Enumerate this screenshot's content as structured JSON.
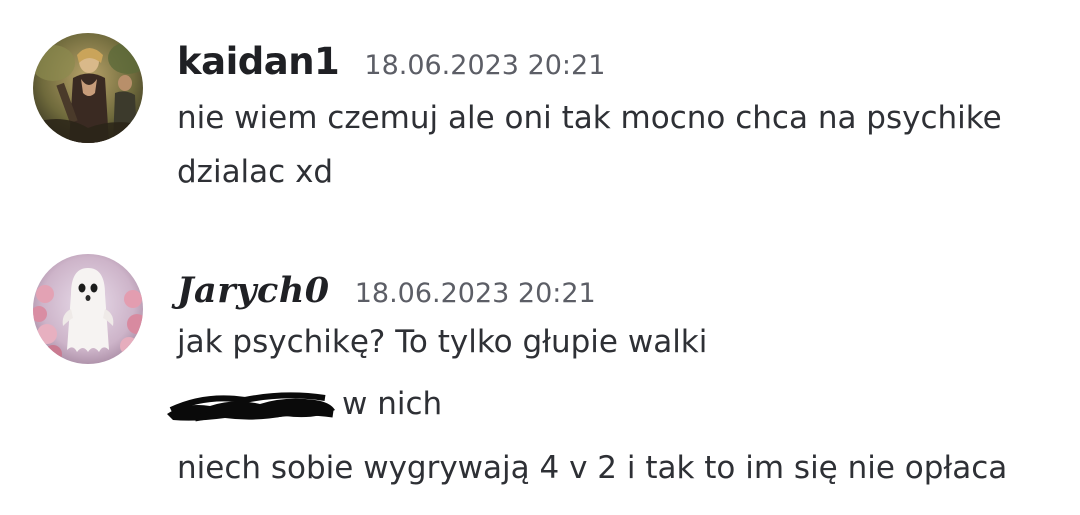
{
  "messages": [
    {
      "username": "kaidan1",
      "timestamp": "18.06.2023 20:21",
      "avatar_icon": "warrior-avatar-icon",
      "lines": [
        "nie wiem czemuj ale oni tak mocno chca na psychike",
        "dzialac xd"
      ]
    },
    {
      "username": "Jarych0",
      "timestamp": "18.06.2023 20:21",
      "avatar_icon": "ghost-avatar-icon",
      "lines": [
        "jak psychikę? To tylko głupie walki",
        "w nich",
        "niech sobie wygrywają 4 v 2 i tak to im się nie opłaca"
      ]
    }
  ],
  "colors": {
    "background": "#ffffff",
    "text": "#2e3035",
    "username": "#1f2024",
    "timestamp": "#5c5e66",
    "redaction": "#0a0a0a"
  }
}
